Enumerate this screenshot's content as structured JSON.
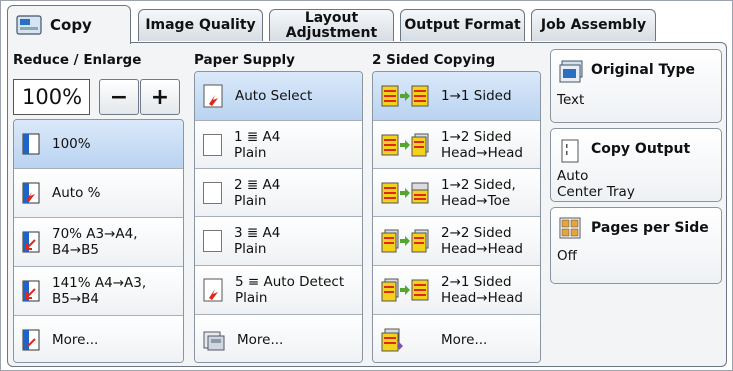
{
  "tabs": [
    {
      "label": "Copy"
    },
    {
      "label": "Image Quality"
    },
    {
      "label": "Layout\nAdjustment"
    },
    {
      "label": "Output Format"
    },
    {
      "label": "Job Assembly"
    }
  ],
  "reduce": {
    "title": "Reduce / Enlarge",
    "value": "100%",
    "minus": "−",
    "plus": "+",
    "items": [
      {
        "label": "100%"
      },
      {
        "label": "Auto %"
      },
      {
        "label": "70% A3→A4,\nB4→B5"
      },
      {
        "label": "141% A4→A3,\nB5→B4"
      },
      {
        "label": "More..."
      }
    ]
  },
  "paper": {
    "title": "Paper Supply",
    "items": [
      {
        "label": "Auto Select"
      },
      {
        "tray": "1",
        "size": "A4",
        "type": "Plain"
      },
      {
        "tray": "2",
        "size": "A4",
        "type": "Plain"
      },
      {
        "tray": "3",
        "size": "A4",
        "type": "Plain"
      },
      {
        "tray": "5",
        "size": "Auto Detect",
        "type": "Plain"
      },
      {
        "label": "More..."
      }
    ]
  },
  "sided": {
    "title": "2 Sided Copying",
    "items": [
      {
        "label": "1→1 Sided"
      },
      {
        "label": "1→2 Sided\nHead→Head"
      },
      {
        "label": "1→2 Sided,\nHead→Toe"
      },
      {
        "label": "2→2 Sided\nHead→Head"
      },
      {
        "label": "2→1 Sided\nHead→Head"
      },
      {
        "label": "More..."
      }
    ]
  },
  "side": {
    "original_type": {
      "title": "Original Type",
      "value": "Text"
    },
    "copy_output": {
      "title": "Copy Output",
      "value": "Auto\nCenter Tray"
    },
    "pages_per_side": {
      "title": "Pages per Side",
      "value": "Off"
    }
  },
  "colors": {
    "selected": "#b9d3f1",
    "accent_red": "#e0271c",
    "accent_yellow": "#f3d21b",
    "accent_green": "#55a630"
  }
}
